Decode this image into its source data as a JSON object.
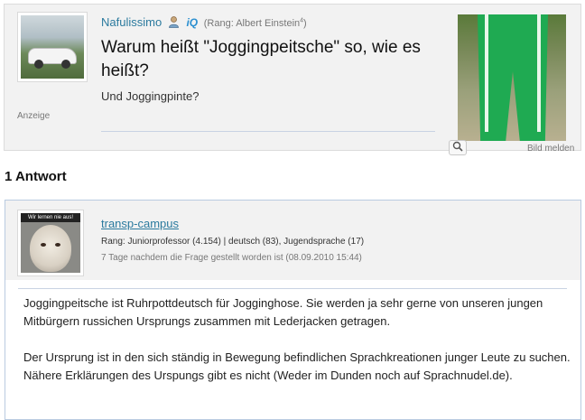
{
  "question": {
    "username": "Nafulissimo",
    "rank_prefix": "(Rang: Albert Einstein",
    "rank_sup": "4",
    "rank_suffix": ")",
    "iq_label": "iQ",
    "title": "Warum heißt \"Joggingpeitsche\" so, wie es heißt?",
    "body": "Und Joggingpinte?",
    "ad_label": "Anzeige",
    "report_image": "Bild melden"
  },
  "answers_heading": "1 Antwort",
  "answer": {
    "avatar_caption": "Wir lernen nie aus!",
    "username": "transp-campus",
    "rank": "Rang: Juniorprofessor (4.154) | deutsch (83), Jugendsprache (17)",
    "time": "7 Tage nachdem die Frage gestellt worden ist (08.09.2010 15:44)",
    "paragraphs": [
      "Joggingpeitsche ist Ruhrpottdeutsch für Jogginghose. Sie werden ja sehr gerne von unseren jungen Mitbürgern russichen Ursprungs zusammen mit Lederjacken getragen.",
      "Der Ursprung ist in den sich ständig in Bewegung befindlichen Sprachkreationen junger Leute zu suchen. Nähere Erklärungen des Urspungs gibt es nicht (Weder im Dunden noch auf Sprachnudel.de)."
    ]
  },
  "colors": {
    "link": "#2b7a9e",
    "panel": "#f2f2f2",
    "answer_border": "#b9cbe0"
  }
}
